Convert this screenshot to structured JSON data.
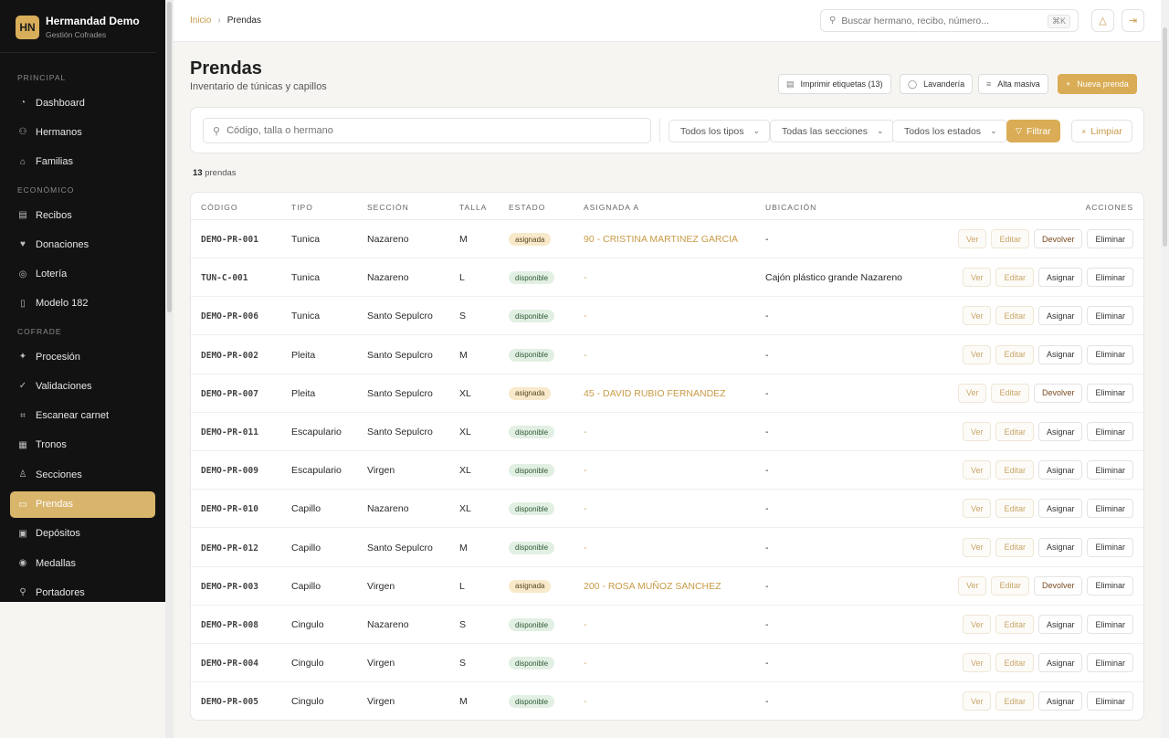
{
  "brand": {
    "initials": "HN",
    "name": "Hermandad Demo",
    "subtitle": "Gestión Cofrades"
  },
  "sidebar": {
    "sections": [
      {
        "label": "PRINCIPAL",
        "items": [
          {
            "label": "Dashboard",
            "icon": "dashboard-icon",
            "glyph": "◔"
          },
          {
            "label": "Hermanos",
            "icon": "users-icon",
            "glyph": "⚇"
          },
          {
            "label": "Familias",
            "icon": "home-icon",
            "glyph": "⌂"
          }
        ]
      },
      {
        "label": "ECONÓMICO",
        "items": [
          {
            "label": "Recibos",
            "icon": "receipt-icon",
            "glyph": "▤"
          },
          {
            "label": "Donaciones",
            "icon": "heart-icon",
            "glyph": "♥"
          },
          {
            "label": "Lotería",
            "icon": "ticket-icon",
            "glyph": "◎"
          },
          {
            "label": "Modelo 182",
            "icon": "file-icon",
            "glyph": "▯"
          }
        ]
      },
      {
        "label": "COFRADE",
        "items": [
          {
            "label": "Procesión",
            "icon": "sparkle-icon",
            "glyph": "✦"
          },
          {
            "label": "Validaciones",
            "icon": "check-circle-icon",
            "glyph": "✓"
          },
          {
            "label": "Escanear carnet",
            "icon": "scan-icon",
            "glyph": "⌗"
          },
          {
            "label": "Tronos",
            "icon": "grid-icon",
            "glyph": "▦"
          },
          {
            "label": "Secciones",
            "icon": "person-icon",
            "glyph": "♙"
          },
          {
            "label": "Prendas",
            "icon": "shirt-icon",
            "glyph": "▭",
            "active": true
          },
          {
            "label": "Depósitos",
            "icon": "box-icon",
            "glyph": "▣"
          },
          {
            "label": "Medallas",
            "icon": "medal-icon",
            "glyph": "◉"
          },
          {
            "label": "Portadores",
            "icon": "carrier-icon",
            "glyph": "⚲"
          }
        ]
      }
    ]
  },
  "topbar": {
    "breadcrumb_home": "Inicio",
    "breadcrumb_sep": "›",
    "breadcrumb_current": "Prendas",
    "search_placeholder": "Buscar hermano, recibo, número...",
    "search_kbd": "⌘K"
  },
  "header": {
    "title": "Prendas",
    "subtitle": "Inventario de túnicas y capillos",
    "buttons": {
      "print": "Imprimir etiquetas (13)",
      "laundry": "Lavandería",
      "bulk": "Alta masiva",
      "new": "Nueva prenda"
    }
  },
  "filters": {
    "search_placeholder": "Código, talla o hermano",
    "tipo": "Todos los tipos",
    "seccion": "Todas las secciones",
    "estado": "Todos los estados",
    "filter_label": "Filtrar",
    "clear_label": "Limpiar"
  },
  "count": {
    "number": "13",
    "label": "prendas"
  },
  "table": {
    "columns": [
      "CÓDIGO",
      "TIPO",
      "SECCIÓN",
      "TALLA",
      "ESTADO",
      "ASIGNADA A",
      "UBICACIÓN",
      "ACCIONES"
    ],
    "actions": {
      "ver": "Ver",
      "editar": "Editar",
      "asignar": "Asignar",
      "devolver": "Devolver",
      "eliminar": "Eliminar"
    },
    "rows": [
      {
        "code": "DEMO-PR-001",
        "tipo": "Tunica",
        "seccion": "Nazareno",
        "talla": "M",
        "estado": "asignada",
        "asignada": "90 - CRISTINA MARTINEZ GARCIA",
        "ubicacion": "-"
      },
      {
        "code": "TUN-C-001",
        "tipo": "Tunica",
        "seccion": "Nazareno",
        "talla": "L",
        "estado": "disponible",
        "asignada": "-",
        "ubicacion": "Cajón plástico grande Nazareno"
      },
      {
        "code": "DEMO-PR-006",
        "tipo": "Tunica",
        "seccion": "Santo Sepulcro",
        "talla": "S",
        "estado": "disponible",
        "asignada": "-",
        "ubicacion": "-"
      },
      {
        "code": "DEMO-PR-002",
        "tipo": "Pleita",
        "seccion": "Santo Sepulcro",
        "talla": "M",
        "estado": "disponible",
        "asignada": "-",
        "ubicacion": "-"
      },
      {
        "code": "DEMO-PR-007",
        "tipo": "Pleita",
        "seccion": "Santo Sepulcro",
        "talla": "XL",
        "estado": "asignada",
        "asignada": "45 - DAVID RUBIO FERNANDEZ",
        "ubicacion": "-"
      },
      {
        "code": "DEMO-PR-011",
        "tipo": "Escapulario",
        "seccion": "Santo Sepulcro",
        "talla": "XL",
        "estado": "disponible",
        "asignada": "-",
        "ubicacion": "-"
      },
      {
        "code": "DEMO-PR-009",
        "tipo": "Escapulario",
        "seccion": "Virgen",
        "talla": "XL",
        "estado": "disponible",
        "asignada": "-",
        "ubicacion": "-"
      },
      {
        "code": "DEMO-PR-010",
        "tipo": "Capillo",
        "seccion": "Nazareno",
        "talla": "XL",
        "estado": "disponible",
        "asignada": "-",
        "ubicacion": "-"
      },
      {
        "code": "DEMO-PR-012",
        "tipo": "Capillo",
        "seccion": "Santo Sepulcro",
        "talla": "M",
        "estado": "disponible",
        "asignada": "-",
        "ubicacion": "-"
      },
      {
        "code": "DEMO-PR-003",
        "tipo": "Capillo",
        "seccion": "Virgen",
        "talla": "L",
        "estado": "asignada",
        "asignada": "200 - ROSA MUÑOZ SANCHEZ",
        "ubicacion": "-"
      },
      {
        "code": "DEMO-PR-008",
        "tipo": "Cingulo",
        "seccion": "Nazareno",
        "talla": "S",
        "estado": "disponible",
        "asignada": "-",
        "ubicacion": "-"
      },
      {
        "code": "DEMO-PR-004",
        "tipo": "Cingulo",
        "seccion": "Virgen",
        "talla": "S",
        "estado": "disponible",
        "asignada": "-",
        "ubicacion": "-"
      },
      {
        "code": "DEMO-PR-005",
        "tipo": "Cingulo",
        "seccion": "Virgen",
        "talla": "M",
        "estado": "disponible",
        "asignada": "-",
        "ubicacion": "-"
      }
    ]
  },
  "colors": {
    "accent": "#d9ac55",
    "sidebar_bg": "#121212",
    "active_nav": "#d9b46b",
    "asignada_badge": "#f7e9c9",
    "disponible_badge": "#e2efe3"
  }
}
